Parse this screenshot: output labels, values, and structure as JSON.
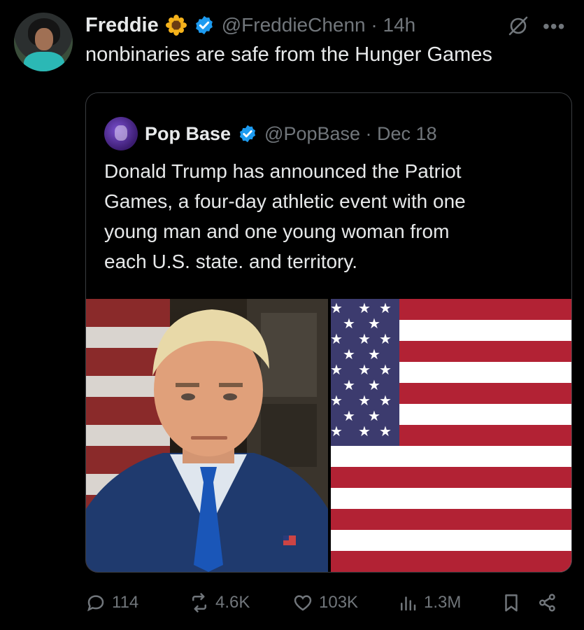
{
  "tweet": {
    "author_name": "Freddie",
    "handle_time": "@FreddieChenn · 14h",
    "text": "nonbinaries are safe from the Hunger Games"
  },
  "quote": {
    "author_name": "Pop Base",
    "handle_time": "@PopBase · Dec 18",
    "lines": [
      "Donald Trump has announced the Patriot",
      "Games, a four-day athletic event with one",
      "young man and one young woman from",
      "each U.S. state. and territory."
    ]
  },
  "actions": {
    "replies": "114",
    "reposts": "4.6K",
    "likes": "103K",
    "views": "1.3M"
  },
  "icons": [
    "sunflower-icon",
    "verified-badge-icon",
    "grok-icon",
    "more-icon",
    "reply-icon",
    "repost-icon",
    "like-icon",
    "views-icon",
    "bookmark-icon",
    "share-icon"
  ],
  "colors": {
    "background": "#000000",
    "text": "#e7e9ea",
    "muted": "#71767b",
    "verified": "#1d9bf0",
    "flag_red": "#b22234",
    "flag_blue": "#3c3b6e"
  }
}
